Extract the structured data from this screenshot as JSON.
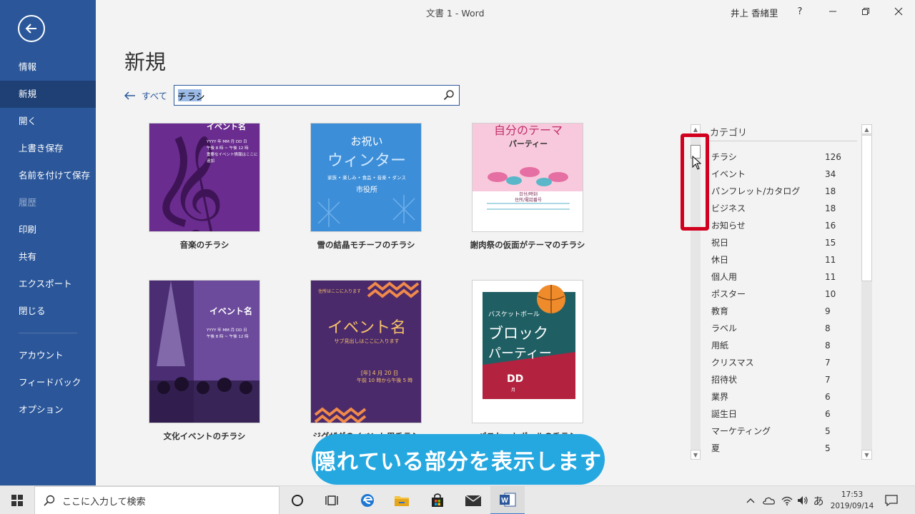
{
  "window": {
    "title": "文書 1  -  Word",
    "user": "井上 香緒里",
    "help_label": "?"
  },
  "sidebar": {
    "items": [
      {
        "label": "情報",
        "state": "normal"
      },
      {
        "label": "新規",
        "state": "active"
      },
      {
        "label": "開く",
        "state": "normal"
      },
      {
        "label": "上書き保存",
        "state": "normal"
      },
      {
        "label": "名前を付けて保存",
        "state": "normal"
      },
      {
        "label": "履歴",
        "state": "disabled"
      },
      {
        "label": "印刷",
        "state": "normal"
      },
      {
        "label": "共有",
        "state": "normal"
      },
      {
        "label": "エクスポート",
        "state": "normal"
      },
      {
        "label": "閉じる",
        "state": "normal"
      }
    ],
    "bottom_items": [
      {
        "label": "アカウント"
      },
      {
        "label": "フィードバック"
      },
      {
        "label": "オプション"
      }
    ]
  },
  "main": {
    "title": "新規",
    "back_link": "すべて",
    "search": {
      "value": "チラシ",
      "placeholder": ""
    }
  },
  "templates": [
    {
      "name": "音楽のチラシ",
      "thumb_heading": "イベント名",
      "thumb_lines": [
        "YYYY 年 MM 月 DD 日",
        "午後 8 時 ~ 午後 12 時",
        "重要なイベント情報はここに追加"
      ]
    },
    {
      "name": "雪の結晶モチーフのチラシ",
      "thumb_heading": "お祝い",
      "thumb_heading2": "ウィンター",
      "thumb_sub": "家族 • 楽しみ • 食品 • 音楽 • ダンス",
      "thumb_place": "市役所"
    },
    {
      "name": "謝肉祭の仮面がテーマのチラシ",
      "thumb_heading": "自分のテーマ",
      "thumb_heading2": "パーティー",
      "thumb_sub": "日付/時刻",
      "thumb_sub2": "住所/電話番号"
    },
    {
      "name": "文化イベントのチラシ",
      "thumb_heading": "イベント名",
      "thumb_lines": [
        "YYYY 年 MM 月 DD 日",
        "午後 8 時 ~ 午後 12 時"
      ]
    },
    {
      "name": "ジグザグのイベント用チラシ",
      "thumb_top": "住所はここに入ります",
      "thumb_heading": "イベント名",
      "thumb_sub": "サブ見出しはここに入ります",
      "thumb_date": "[年] 4 月 20 日",
      "thumb_time": "午前 10 時から午後 5 時"
    },
    {
      "name": "バスケットボールのチラシ",
      "thumb_top": "バスケットボール",
      "thumb_heading": "ブロック",
      "thumb_heading2": "パーティー",
      "thumb_dd": "DD",
      "thumb_mon": "月"
    }
  ],
  "categories": {
    "header": "カテゴリ",
    "items": [
      {
        "name": "チラシ",
        "count": "126"
      },
      {
        "name": "イベント",
        "count": "34"
      },
      {
        "name": "パンフレット/カタログ",
        "count": "18"
      },
      {
        "name": "ビジネス",
        "count": "18"
      },
      {
        "name": "お知らせ",
        "count": "16"
      },
      {
        "name": "祝日",
        "count": "15"
      },
      {
        "name": "休日",
        "count": "11"
      },
      {
        "name": "個人用",
        "count": "11"
      },
      {
        "name": "ポスター",
        "count": "10"
      },
      {
        "name": "教育",
        "count": "9"
      },
      {
        "name": "ラベル",
        "count": "8"
      },
      {
        "name": "用紙",
        "count": "8"
      },
      {
        "name": "クリスマス",
        "count": "7"
      },
      {
        "name": "招待状",
        "count": "7"
      },
      {
        "name": "業界",
        "count": "6"
      },
      {
        "name": "誕生日",
        "count": "6"
      },
      {
        "name": "マーケティング",
        "count": "5"
      },
      {
        "name": "夏",
        "count": "5"
      }
    ]
  },
  "caption": "隠れている部分を表示します",
  "taskbar": {
    "search_placeholder": "ここに入力して検索",
    "ime": "あ",
    "time": "17:53",
    "date": "2019/09/14"
  },
  "colors": {
    "word_blue": "#2b579a",
    "highlight_red": "#d2001f",
    "caption_blue": "#25a8e0"
  }
}
